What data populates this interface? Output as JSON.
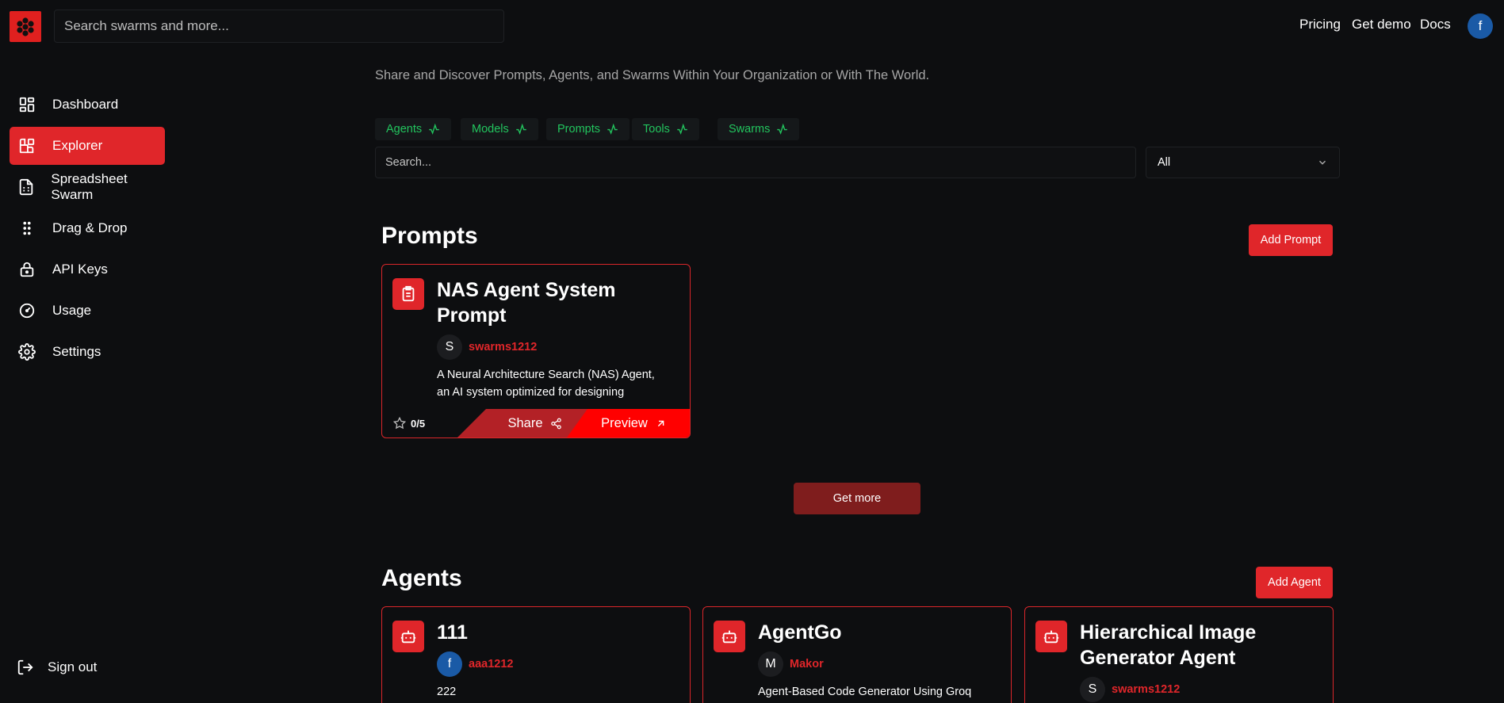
{
  "header": {
    "search_placeholder": "Search swarms and more...",
    "nav": [
      "Pricing",
      "Get demo",
      "Docs"
    ],
    "avatar_letter": "f"
  },
  "sidebar": {
    "items": [
      {
        "label": "Dashboard",
        "icon": "dashboard-icon",
        "active": false
      },
      {
        "label": "Explorer",
        "icon": "explorer-icon",
        "active": true
      },
      {
        "label": "Spreadsheet Swarm",
        "icon": "spreadsheet-icon",
        "active": false
      },
      {
        "label": "Drag & Drop",
        "icon": "drag-dots-icon",
        "active": false
      },
      {
        "label": "API Keys",
        "icon": "lock-icon",
        "active": false
      },
      {
        "label": "Usage",
        "icon": "gauge-icon",
        "active": false
      },
      {
        "label": "Settings",
        "icon": "gear-icon",
        "active": false
      }
    ],
    "sign_out": "Sign out"
  },
  "main": {
    "tagline": "Share and Discover Prompts, Agents, and Swarms Within Your Organization or With The World.",
    "tabs": [
      "Agents",
      "Models",
      "Prompts",
      "Tools",
      "Swarms"
    ],
    "search_placeholder": "Search...",
    "filter_value": "All"
  },
  "prompts": {
    "title": "Prompts",
    "add_label": "Add Prompt",
    "get_more_label": "Get more",
    "cards": [
      {
        "title": "NAS Agent System Prompt",
        "author_initial": "S",
        "author": "swarms1212",
        "description": "A Neural Architecture Search (NAS) Agent, an AI system optimized for designing",
        "rating": "0/5",
        "share_label": "Share",
        "preview_label": "Preview"
      }
    ]
  },
  "agents": {
    "title": "Agents",
    "add_label": "Add Agent",
    "cards": [
      {
        "title": "111",
        "author_initial": "f",
        "author": "aaa1212",
        "description": "222"
      },
      {
        "title": "AgentGo",
        "author_initial": "M",
        "author": "Makor",
        "description": "Agent-Based Code Generator Using Groq"
      },
      {
        "title": "Hierarchical Image Generator Agent",
        "author_initial": "S",
        "author": "swarms1212",
        "description": ""
      }
    ]
  },
  "colors": {
    "background": "#0d0e10",
    "accent": "#e0262a",
    "tab_text": "#22c55e"
  }
}
